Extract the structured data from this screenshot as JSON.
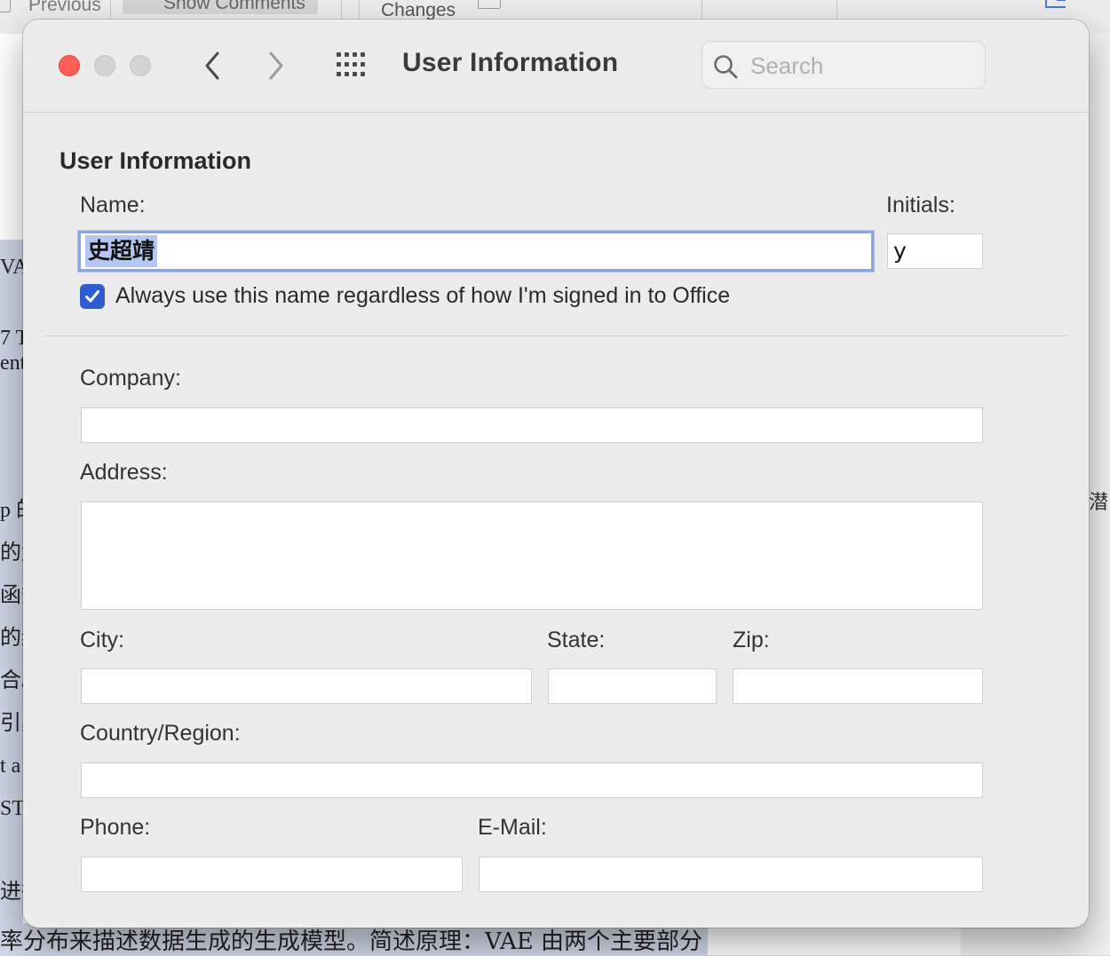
{
  "background": {
    "toolbar": {
      "previous_label": "Previous",
      "show_comments_label": "Show Comments",
      "changes_label": "Changes"
    },
    "document_fragments": [
      "VA",
      "7 T",
      "ent",
      "p 的",
      "的解",
      "函数",
      "的约",
      "合。",
      "引其",
      "t a",
      "ST",
      "进行"
    ],
    "bottom_text": "率分布来描述数据生成的生成模型。简述原理：VAE 由两个主要部分",
    "side_char": "潜"
  },
  "dialog": {
    "title": "User Information",
    "search": {
      "placeholder": "Search",
      "value": ""
    },
    "section_title": "User Information",
    "name": {
      "label": "Name:",
      "value": "史超靖"
    },
    "initials": {
      "label": "Initials:",
      "value": "y"
    },
    "always_use": {
      "label": "Always use this name regardless of how I'm signed in to Office",
      "checked": true
    },
    "company": {
      "label": "Company:",
      "value": ""
    },
    "address": {
      "label": "Address:",
      "value": ""
    },
    "city": {
      "label": "City:",
      "value": ""
    },
    "state": {
      "label": "State:",
      "value": ""
    },
    "zip": {
      "label": "Zip:",
      "value": ""
    },
    "country": {
      "label": "Country/Region:",
      "value": ""
    },
    "phone": {
      "label": "Phone:",
      "value": ""
    },
    "email": {
      "label": "E-Mail:",
      "value": ""
    }
  },
  "colors": {
    "close_button": "#fe5f57",
    "checkbox_accent": "#2f5cd1",
    "focus_ring": "#8ca4df",
    "selection": "#b3c7f2"
  },
  "icons": [
    "chevron-left-icon",
    "chevron-right-icon",
    "grid-icon",
    "search-icon",
    "checkmark-icon"
  ]
}
